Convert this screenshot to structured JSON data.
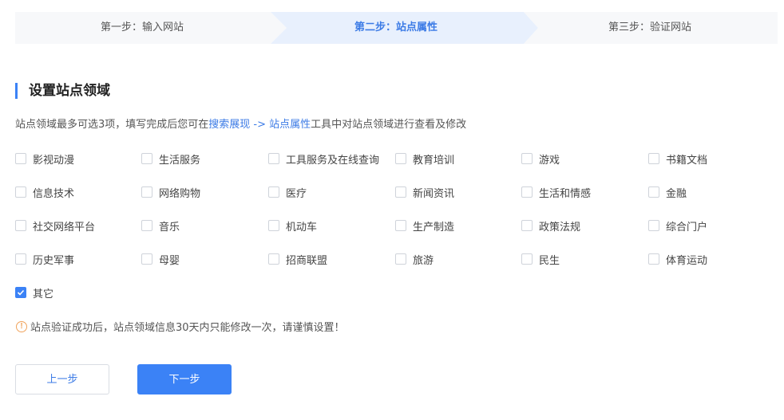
{
  "steps": [
    {
      "label": "第一步：输入网站",
      "state": "done"
    },
    {
      "label": "第二步：站点属性",
      "state": "active"
    },
    {
      "label": "第三步：验证网站",
      "state": "todo"
    }
  ],
  "section_title": "设置站点领域",
  "description": {
    "prefix": "站点领域最多可选3项，填写完成后您可在",
    "link": "搜索展现 -> 站点属性",
    "suffix": "工具中对站点领域进行查看及修改"
  },
  "categories": [
    {
      "label": "影视动漫",
      "checked": false
    },
    {
      "label": "生活服务",
      "checked": false
    },
    {
      "label": "工具服务及在线查询",
      "checked": false
    },
    {
      "label": "教育培训",
      "checked": false
    },
    {
      "label": "游戏",
      "checked": false
    },
    {
      "label": "书籍文档",
      "checked": false
    },
    {
      "label": "信息技术",
      "checked": false
    },
    {
      "label": "网络购物",
      "checked": false
    },
    {
      "label": "医疗",
      "checked": false
    },
    {
      "label": "新闻资讯",
      "checked": false
    },
    {
      "label": "生活和情感",
      "checked": false
    },
    {
      "label": "金融",
      "checked": false
    },
    {
      "label": "社交网络平台",
      "checked": false
    },
    {
      "label": "音乐",
      "checked": false
    },
    {
      "label": "机动车",
      "checked": false
    },
    {
      "label": "生产制造",
      "checked": false
    },
    {
      "label": "政策法规",
      "checked": false
    },
    {
      "label": "综合门户",
      "checked": false
    },
    {
      "label": "历史军事",
      "checked": false
    },
    {
      "label": "母婴",
      "checked": false
    },
    {
      "label": "招商联盟",
      "checked": false
    },
    {
      "label": "旅游",
      "checked": false
    },
    {
      "label": "民生",
      "checked": false
    },
    {
      "label": "体育运动",
      "checked": false
    },
    {
      "label": "其它",
      "checked": true
    }
  ],
  "warning": {
    "icon": "!",
    "text": "站点验证成功后，站点领域信息30天内只能修改一次，请谨慎设置！"
  },
  "buttons": {
    "prev": "上一步",
    "next": "下一步"
  },
  "colors": {
    "accent": "#3b82f6",
    "link": "#3c7be6",
    "warning": "#f0a35c",
    "step_active_bg": "#e8f0fd",
    "step_bg": "#f7f8fa"
  }
}
